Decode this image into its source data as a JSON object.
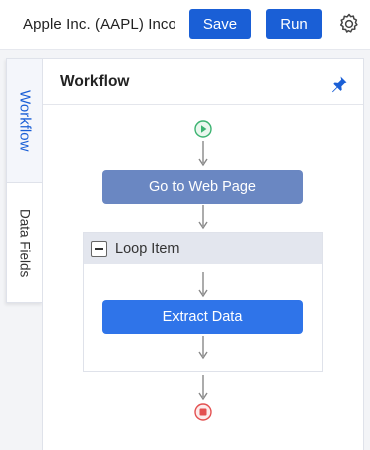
{
  "header": {
    "task_title": "Apple Inc. (AAPL) Inco...",
    "save_label": "Save",
    "run_label": "Run",
    "settings_icon": "gear-icon"
  },
  "side_tabs": [
    {
      "label": "Workflow",
      "active": true
    },
    {
      "label": "Data Fields",
      "active": false
    }
  ],
  "panel": {
    "title": "Workflow",
    "pin_icon": "pin-icon"
  },
  "flow": {
    "start_icon": "play-icon",
    "steps": [
      {
        "label": "Go to Web Page"
      }
    ],
    "loop": {
      "label": "Loop Item",
      "steps": [
        {
          "label": "Extract Data"
        }
      ]
    },
    "end_icon": "stop-icon"
  },
  "colors": {
    "accent": "#1a5fd6",
    "step_goto": "#6a87c2",
    "step_extract": "#2f74e9",
    "start": "#3cb371",
    "end": "#e35050"
  }
}
